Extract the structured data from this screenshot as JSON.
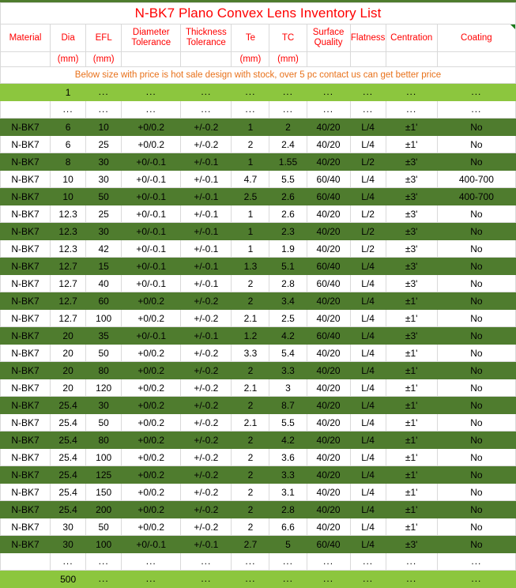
{
  "document": {
    "title": "N-BK7 Plano Convex Lens Inventory List",
    "title_color": "#FF0000",
    "note": "Below size with price is hot sale design with stock, over 5 pc contact us can get better price",
    "note_color": "#E8711A",
    "comment_flag_color": "#1A7A1A"
  },
  "theme": {
    "row_dark_green": "#4F7C2E",
    "row_light_green": "#8CC63E",
    "row_white": "#FFFFFF",
    "gridline": "#D9D9D9",
    "header_text": "#FF0000"
  },
  "table": {
    "columns": [
      {
        "key": "material",
        "label_line1": "Material",
        "label_line2": "",
        "unit": ""
      },
      {
        "key": "dia",
        "label_line1": "Dia",
        "label_line2": "",
        "unit": "(mm)"
      },
      {
        "key": "efl",
        "label_line1": "EFL",
        "label_line2": "",
        "unit": "(mm)"
      },
      {
        "key": "dia_tol",
        "label_line1": "Diameter",
        "label_line2": "Tolerance",
        "unit": ""
      },
      {
        "key": "thk_tol",
        "label_line1": "Thickness",
        "label_line2": "Tolerance",
        "unit": ""
      },
      {
        "key": "te",
        "label_line1": "Te",
        "label_line2": "",
        "unit": "(mm)"
      },
      {
        "key": "tc",
        "label_line1": "TC",
        "label_line2": "",
        "unit": "(mm)"
      },
      {
        "key": "surface",
        "label_line1": "Surface",
        "label_line2": "Quality",
        "unit": ""
      },
      {
        "key": "flatness",
        "label_line1": "Flatness",
        "label_line2": "",
        "unit": ""
      },
      {
        "key": "centration",
        "label_line1": "Centration",
        "label_line2": "",
        "unit": ""
      },
      {
        "key": "coating",
        "label_line1": "Coating",
        "label_line2": "",
        "unit": ""
      }
    ],
    "ellipsis": "...",
    "top_marker_rows": [
      {
        "style": "light",
        "cells": [
          "",
          "1",
          "...",
          "...",
          "...",
          "...",
          "...",
          "...",
          "...",
          "...",
          "..."
        ]
      },
      {
        "style": "white",
        "cells": [
          "",
          "...",
          "...",
          "...",
          "...",
          "...",
          "...",
          "...",
          "...",
          "...",
          "..."
        ]
      }
    ],
    "rows": [
      {
        "style": "dark",
        "cells": [
          "N-BK7",
          "6",
          "10",
          "+0/0.2",
          "+/-0.2",
          "1",
          "2",
          "40/20",
          "L/4",
          "±1'",
          "No"
        ]
      },
      {
        "style": "white",
        "cells": [
          "N-BK7",
          "6",
          "25",
          "+0/0.2",
          "+/-0.2",
          "2",
          "2.4",
          "40/20",
          "L/4",
          "±1'",
          "No"
        ]
      },
      {
        "style": "dark",
        "cells": [
          "N-BK7",
          "8",
          "30",
          "+0/-0.1",
          "+/-0.1",
          "1",
          "1.55",
          "40/20",
          "L/2",
          "±3'",
          "No"
        ]
      },
      {
        "style": "white",
        "cells": [
          "N-BK7",
          "10",
          "30",
          "+0/-0.1",
          "+/-0.1",
          "4.7",
          "5.5",
          "60/40",
          "L/4",
          "±3'",
          "400-700"
        ]
      },
      {
        "style": "dark",
        "cells": [
          "N-BK7",
          "10",
          "50",
          "+0/-0.1",
          "+/-0.1",
          "2.5",
          "2.6",
          "60/40",
          "L/4",
          "±3'",
          "400-700"
        ]
      },
      {
        "style": "white",
        "cells": [
          "N-BK7",
          "12.3",
          "25",
          "+0/-0.1",
          "+/-0.1",
          "1",
          "2.6",
          "40/20",
          "L/2",
          "±3'",
          "No"
        ]
      },
      {
        "style": "dark",
        "cells": [
          "N-BK7",
          "12.3",
          "30",
          "+0/-0.1",
          "+/-0.1",
          "1",
          "2.3",
          "40/20",
          "L/2",
          "±3'",
          "No"
        ]
      },
      {
        "style": "white",
        "cells": [
          "N-BK7",
          "12.3",
          "42",
          "+0/-0.1",
          "+/-0.1",
          "1",
          "1.9",
          "40/20",
          "L/2",
          "±3'",
          "No"
        ]
      },
      {
        "style": "dark",
        "cells": [
          "N-BK7",
          "12.7",
          "15",
          "+0/-0.1",
          "+/-0.1",
          "1.3",
          "5.1",
          "60/40",
          "L/4",
          "±3'",
          "No"
        ]
      },
      {
        "style": "white",
        "cells": [
          "N-BK7",
          "12.7",
          "40",
          "+0/-0.1",
          "+/-0.1",
          "2",
          "2.8",
          "60/40",
          "L/4",
          "±3'",
          "No"
        ]
      },
      {
        "style": "dark",
        "cells": [
          "N-BK7",
          "12.7",
          "60",
          "+0/0.2",
          "+/-0.2",
          "2",
          "3.4",
          "40/20",
          "L/4",
          "±1'",
          "No"
        ]
      },
      {
        "style": "white",
        "cells": [
          "N-BK7",
          "12.7",
          "100",
          "+0/0.2",
          "+/-0.2",
          "2.1",
          "2.5",
          "40/20",
          "L/4",
          "±1'",
          "No"
        ]
      },
      {
        "style": "dark",
        "cells": [
          "N-BK7",
          "20",
          "35",
          "+0/-0.1",
          "+/-0.1",
          "1.2",
          "4.2",
          "60/40",
          "L/4",
          "±3'",
          "No"
        ]
      },
      {
        "style": "white",
        "cells": [
          "N-BK7",
          "20",
          "50",
          "+0/0.2",
          "+/-0.2",
          "3.3",
          "5.4",
          "40/20",
          "L/4",
          "±1'",
          "No"
        ]
      },
      {
        "style": "dark",
        "cells": [
          "N-BK7",
          "20",
          "80",
          "+0/0.2",
          "+/-0.2",
          "2",
          "3.3",
          "40/20",
          "L/4",
          "±1'",
          "No"
        ]
      },
      {
        "style": "white",
        "cells": [
          "N-BK7",
          "20",
          "120",
          "+0/0.2",
          "+/-0.2",
          "2.1",
          "3",
          "40/20",
          "L/4",
          "±1'",
          "No"
        ]
      },
      {
        "style": "dark",
        "cells": [
          "N-BK7",
          "25.4",
          "30",
          "+0/0.2",
          "+/-0.2",
          "2",
          "8.7",
          "40/20",
          "L/4",
          "±1'",
          "No"
        ]
      },
      {
        "style": "white",
        "cells": [
          "N-BK7",
          "25.4",
          "50",
          "+0/0.2",
          "+/-0.2",
          "2.1",
          "5.5",
          "40/20",
          "L/4",
          "±1'",
          "No"
        ]
      },
      {
        "style": "dark",
        "cells": [
          "N-BK7",
          "25.4",
          "80",
          "+0/0.2",
          "+/-0.2",
          "2",
          "4.2",
          "40/20",
          "L/4",
          "±1'",
          "No"
        ]
      },
      {
        "style": "white",
        "cells": [
          "N-BK7",
          "25.4",
          "100",
          "+0/0.2",
          "+/-0.2",
          "2",
          "3.6",
          "40/20",
          "L/4",
          "±1'",
          "No"
        ]
      },
      {
        "style": "dark",
        "cells": [
          "N-BK7",
          "25.4",
          "125",
          "+0/0.2",
          "+/-0.2",
          "2",
          "3.3",
          "40/20",
          "L/4",
          "±1'",
          "No"
        ]
      },
      {
        "style": "white",
        "cells": [
          "N-BK7",
          "25.4",
          "150",
          "+0/0.2",
          "+/-0.2",
          "2",
          "3.1",
          "40/20",
          "L/4",
          "±1'",
          "No"
        ]
      },
      {
        "style": "dark",
        "cells": [
          "N-BK7",
          "25.4",
          "200",
          "+0/0.2",
          "+/-0.2",
          "2",
          "2.8",
          "40/20",
          "L/4",
          "±1'",
          "No"
        ]
      },
      {
        "style": "white",
        "cells": [
          "N-BK7",
          "30",
          "50",
          "+0/0.2",
          "+/-0.2",
          "2",
          "6.6",
          "40/20",
          "L/4",
          "±1'",
          "No"
        ]
      },
      {
        "style": "dark",
        "cells": [
          "N-BK7",
          "30",
          "100",
          "+0/-0.1",
          "+/-0.1",
          "2.7",
          "5",
          "60/40",
          "L/4",
          "±3'",
          "No"
        ]
      }
    ],
    "bottom_marker_rows": [
      {
        "style": "white",
        "cells": [
          "",
          "...",
          "...",
          "...",
          "...",
          "...",
          "...",
          "...",
          "...",
          "...",
          "..."
        ]
      },
      {
        "style": "light",
        "cells": [
          "",
          "500",
          "...",
          "...",
          "...",
          "...",
          "...",
          "...",
          "...",
          "...",
          "..."
        ]
      }
    ]
  }
}
